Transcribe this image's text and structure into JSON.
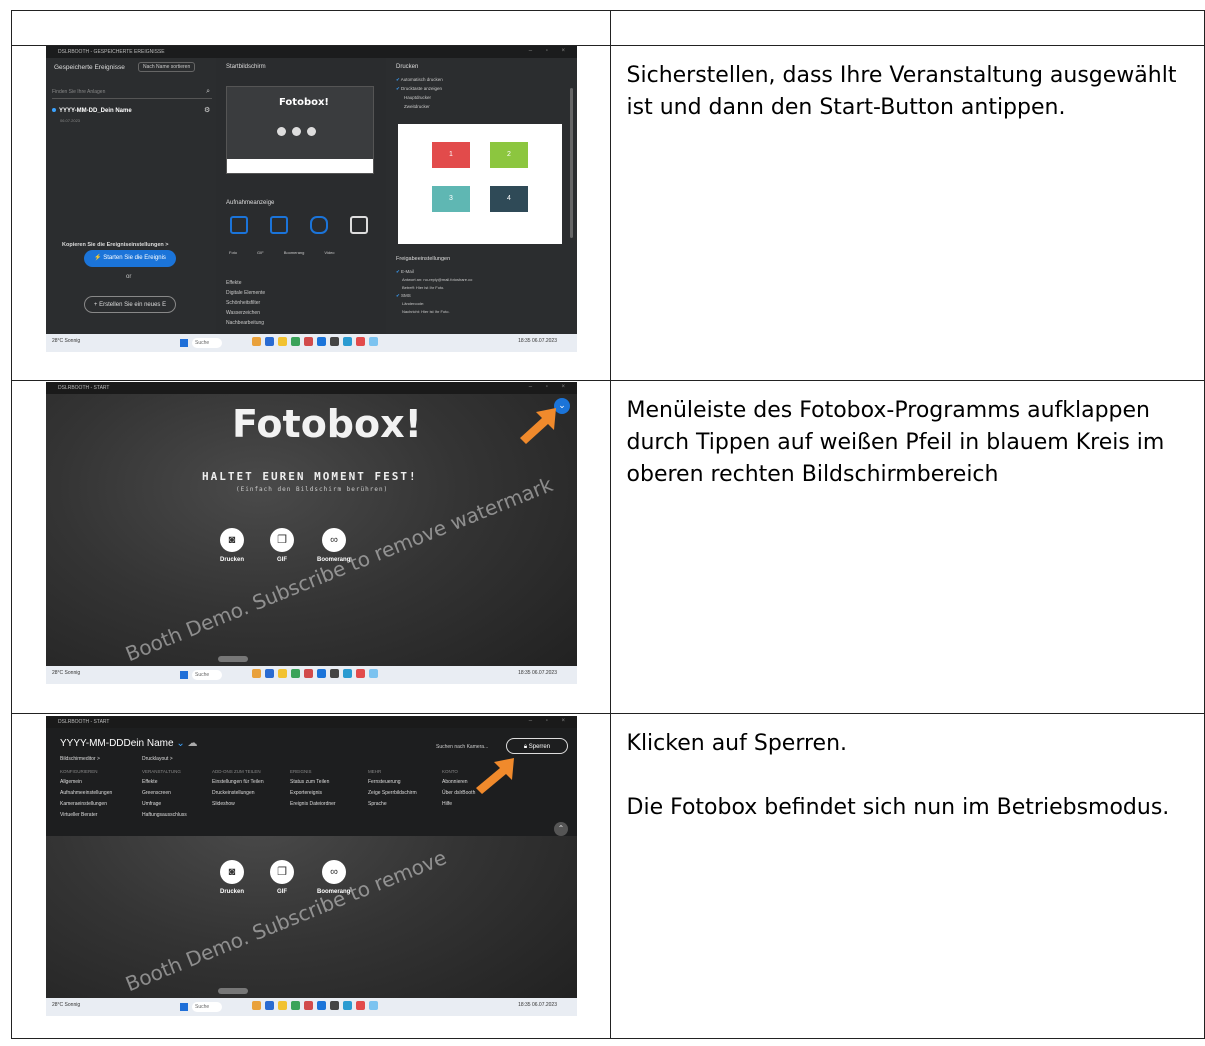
{
  "rows": [
    {
      "instructions": [
        "Sicherstellen, dass Ihre Veranstaltung ausgewählt ist und dann den Start-Button antippen."
      ]
    },
    {
      "instructions": [
        "Menüleiste des Fotobox-Programms aufklappen durch Tippen auf weißen Pfeil in blauem Kreis im oberen rechten Bildschirmbereich"
      ]
    },
    {
      "instructions": [
        "Klicken auf Sperren.",
        "Die Fotobox befindet sich nun im Betriebsmodus."
      ]
    }
  ],
  "shot1": {
    "window_title": "DSLRBOOTH - GESPEICHERTE EREIGNISSE",
    "saved_events_label": "Gespeicherte Ereignisse",
    "sort_label": "Nach Name sortieren",
    "search_placeholder": "Finden Sie Ihre Anlagen",
    "event_name": "YYYY-MM-DD_Dein Name",
    "event_date": "06.07.2023",
    "startscreen_label": "Startbildschirm",
    "preview_logo": "Fotobox!",
    "capture_label": "Aufnahmeanzeige",
    "modes": [
      "Foto",
      "GIF",
      "Boomerang",
      "Video"
    ],
    "copy_settings": "Kopieren Sie die Ereigniseinstellungen >",
    "start_button": "Starten Sie die Ereignis",
    "or_label": "or",
    "new_button": "Erstellen Sie ein neues E",
    "mid_menu": [
      "Effekte",
      "Digitale Elemente",
      "Schönheitsfilter",
      "Wasserzeichen",
      "Nachbearbeitung"
    ],
    "print_label": "Drucken",
    "print_options": [
      "Automatisch drucken",
      "Drucktaste anzeigen",
      "Hauptdrucker",
      "Zweitdrucker"
    ],
    "tiles": [
      {
        "label": "1",
        "color": "#e24b4b"
      },
      {
        "label": "2",
        "color": "#8cc63f"
      },
      {
        "label": "3",
        "color": "#5fb7b3"
      },
      {
        "label": "4",
        "color": "#2f4a57"
      }
    ],
    "share_label": "Freigabeeinstellungen",
    "share_options": [
      "E-Mail",
      "Antwort an: no-reply@mail.fotoshare.co",
      "Betreff: Hier ist Ihr Foto.",
      "SMS",
      "Ländercode:",
      "Nachricht: Hier ist Ihr Foto."
    ]
  },
  "shot2": {
    "window_title": "DSLRBOOTH - START",
    "title": "Fotobox!",
    "slogan": "HALTET EUREN MOMENT FEST!",
    "subslogan": "(Einfach den Bildschirm berühren)",
    "watermark": "Booth Demo. Subscribe to remove watermark",
    "modes": [
      "Drucken",
      "GIF",
      "Boomerang"
    ]
  },
  "shot3": {
    "window_title": "DSLRBOOTH - START",
    "event_name": "YYYY-MM-DDDein Name",
    "top_links": [
      "Bildschirmeditor >",
      "Drucklayout >"
    ],
    "suchen": "Suchen nach Kamera...",
    "sperren": "Sperren",
    "cols": [
      {
        "head": "KONFIGURIEREN",
        "items": [
          "Allgemein",
          "Aufnahmeeinstellungen",
          "Kameraeinstellungen",
          "Virtueller Berater"
        ]
      },
      {
        "head": "VERANSTALTUNG",
        "items": [
          "Effekte",
          "Greenscreen",
          "Umfrage",
          "Haftungsausschluss"
        ]
      },
      {
        "head": "ADD-ONS ZUM TEILEN",
        "items": [
          "Einstellungen für Teilen",
          "Druckeinstellungen",
          "Slideshow"
        ]
      },
      {
        "head": "EREIGNIS",
        "items": [
          "Status zum Teilen",
          "Exportereignis",
          "Ereignis Dateiordner"
        ]
      },
      {
        "head": "MEHR",
        "items": [
          "Fernsteuerung",
          "Zeige Sperrbildschirm",
          "Sprache"
        ]
      },
      {
        "head": "KONTO",
        "items": [
          "Abonnieren",
          "Über dslrBooth",
          "Hilfe"
        ]
      }
    ],
    "watermark": "Booth Demo. Subscribe to remove",
    "modes": [
      "Drucken",
      "GIF",
      "Boomerang"
    ]
  },
  "taskbar": {
    "search": "Suche",
    "weather": "28°C Sonnig",
    "clock": "18:35 06.07.2023"
  }
}
